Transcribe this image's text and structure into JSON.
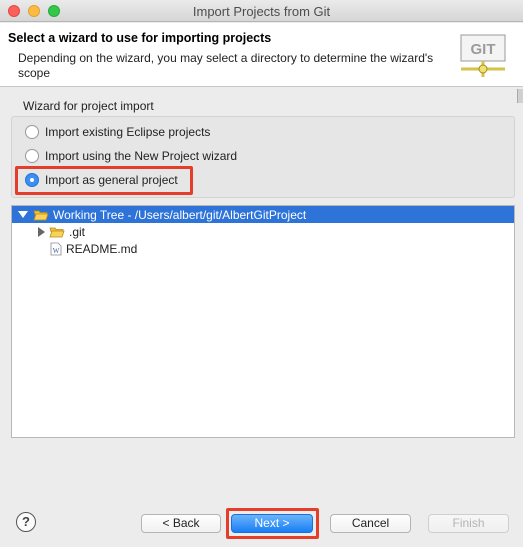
{
  "window": {
    "title": "Import Projects from Git"
  },
  "banner": {
    "title": "Select a wizard to use for importing projects",
    "description": "Depending on the wizard, you may select a directory to determine the wizard's scope",
    "logo_text": "GIT"
  },
  "wizard_group": {
    "label": "Wizard for project import",
    "options": [
      {
        "label": "Import existing Eclipse projects",
        "selected": false
      },
      {
        "label": "Import using the New Project wizard",
        "selected": false
      },
      {
        "label": "Import as general project",
        "selected": true
      }
    ]
  },
  "tree": {
    "rows": [
      {
        "label": "Working Tree - /Users/albert/git/AlbertGitProject",
        "kind": "folder-open",
        "expanded": true,
        "selected": true
      },
      {
        "label": ".git",
        "kind": "folder",
        "expanded": false,
        "selected": false
      },
      {
        "label": "README.md",
        "kind": "file",
        "selected": false
      }
    ]
  },
  "buttons": {
    "help": "?",
    "back": "< Back",
    "next": "Next >",
    "cancel": "Cancel",
    "finish": "Finish"
  },
  "colors": {
    "selection": "#2e73d8",
    "primary_button": "#187ef6",
    "highlight": "#e43e2b"
  }
}
